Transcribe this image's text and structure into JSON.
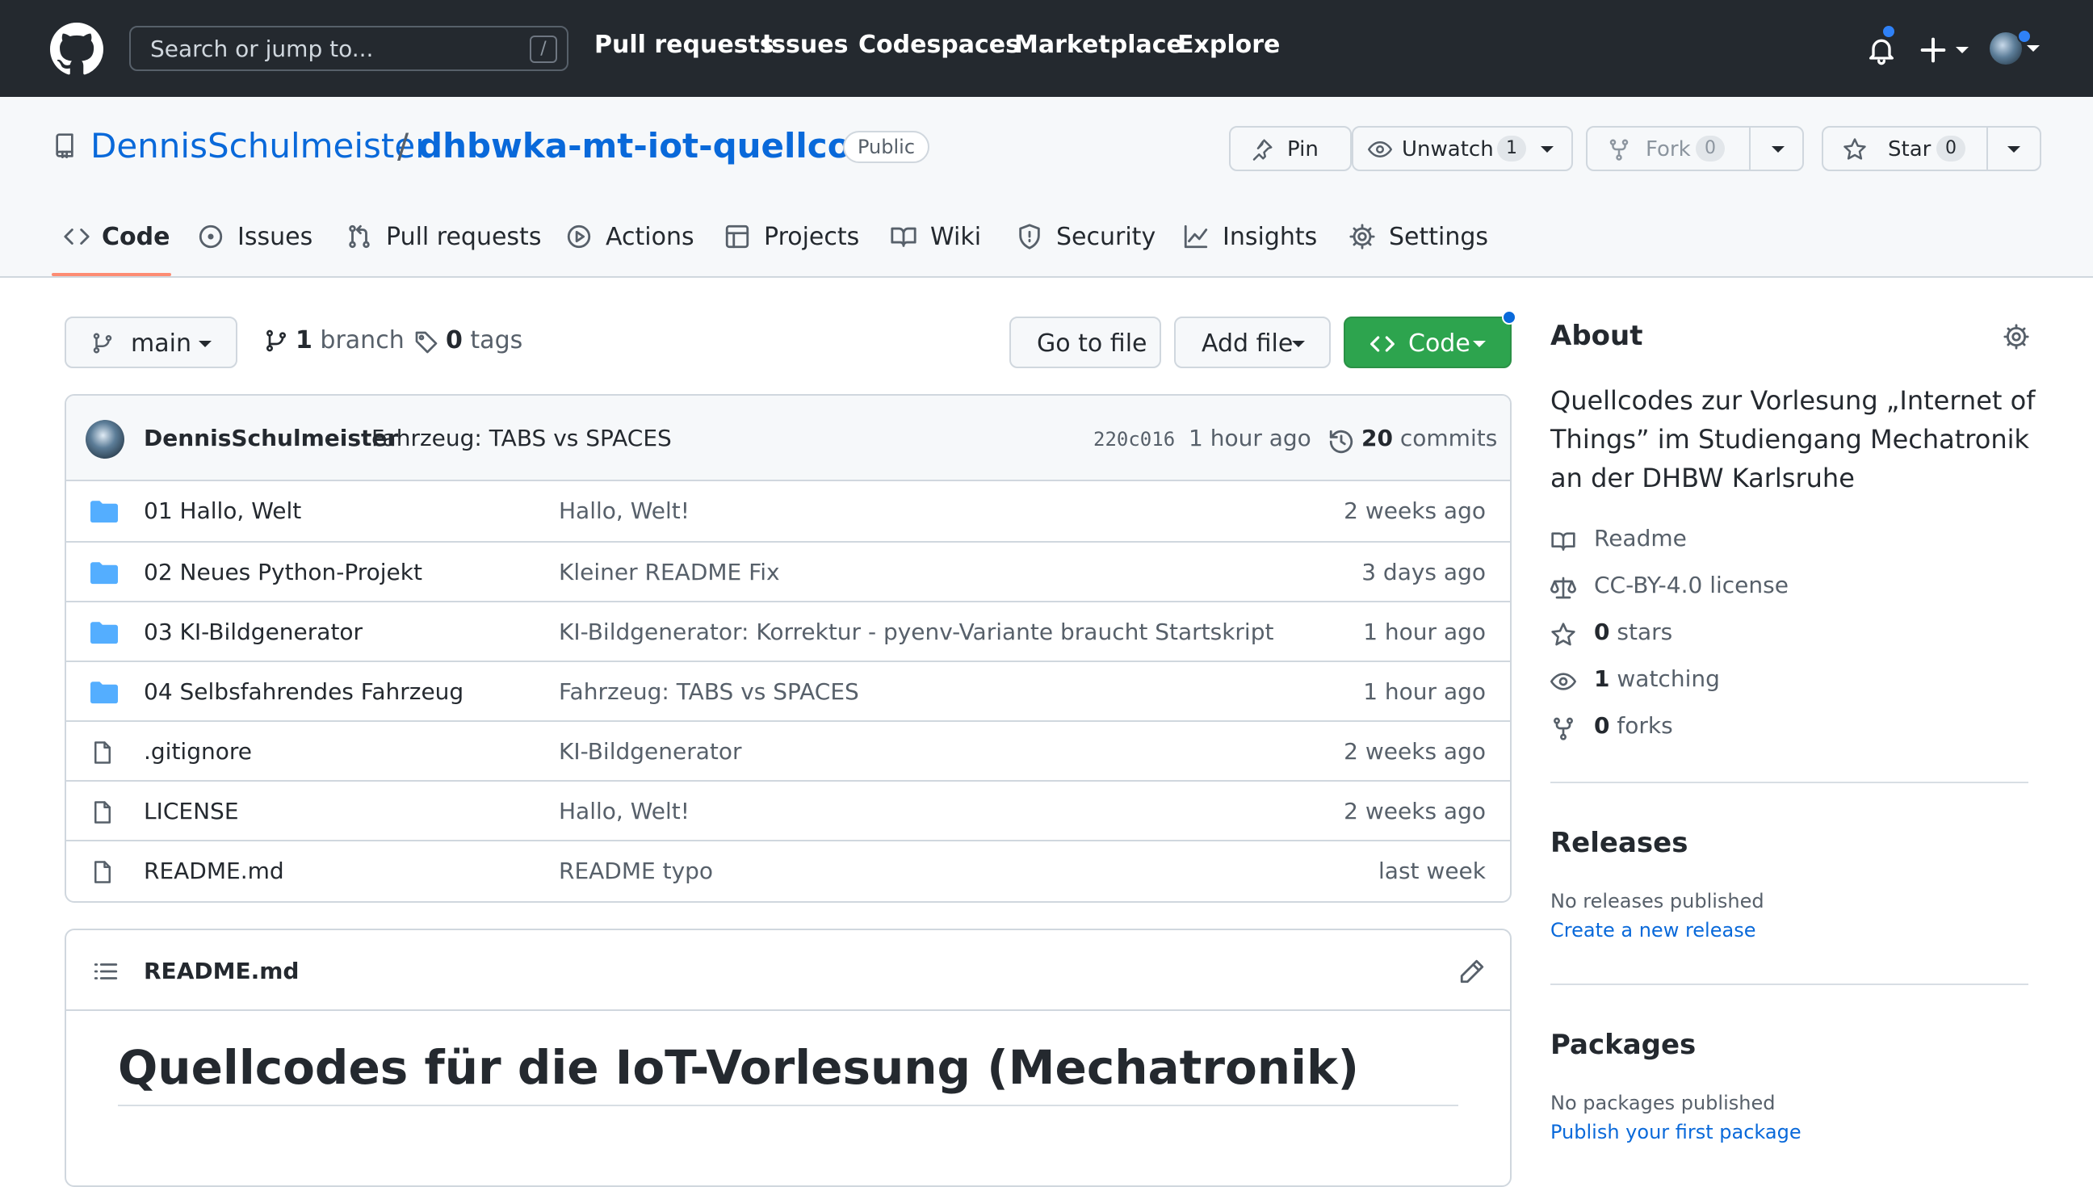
{
  "header": {
    "search_placeholder": "Search or jump to...",
    "search_shortcut": "/",
    "nav": [
      "Pull requests",
      "Issues",
      "Codespaces",
      "Marketplace",
      "Explore"
    ]
  },
  "repo": {
    "owner": "DennisSchulmeister",
    "separator": "/",
    "name": "dhbwka-mt-iot-quellcodes",
    "visibility": "Public",
    "pin_label": "Pin",
    "unwatch_label": "Unwatch",
    "watch_count": "1",
    "fork_label": "Fork",
    "fork_count": "0",
    "star_label": "Star",
    "star_count": "0"
  },
  "tabs": [
    "Code",
    "Issues",
    "Pull requests",
    "Actions",
    "Projects",
    "Wiki",
    "Security",
    "Insights",
    "Settings"
  ],
  "branchbar": {
    "branch": "main",
    "branch_count": "1",
    "branch_word": "branch",
    "tag_count": "0",
    "tag_word": "tags",
    "go_to_file": "Go to file",
    "add_file": "Add file",
    "code": "Code"
  },
  "commit": {
    "author": "DennisSchulmeister",
    "message": "Fahrzeug: TABS vs SPACES",
    "sha": "220c016",
    "time": "1 hour ago",
    "count": "20",
    "count_word": "commits"
  },
  "files": [
    {
      "type": "dir",
      "name": "01 Hallo, Welt",
      "message": "Hallo, Welt!",
      "age": "2 weeks ago"
    },
    {
      "type": "dir",
      "name": "02 Neues Python-Projekt",
      "message": "Kleiner README Fix",
      "age": "3 days ago"
    },
    {
      "type": "dir",
      "name": "03 KI-Bildgenerator",
      "message": "KI-Bildgenerator: Korrektur - pyenv-Variante braucht Startskript",
      "age": "1 hour ago"
    },
    {
      "type": "dir",
      "name": "04 Selbsfahrendes Fahrzeug",
      "message": "Fahrzeug: TABS vs SPACES",
      "age": "1 hour ago"
    },
    {
      "type": "file",
      "name": ".gitignore",
      "message": "KI-Bildgenerator",
      "age": "2 weeks ago"
    },
    {
      "type": "file",
      "name": "LICENSE",
      "message": "Hallo, Welt!",
      "age": "2 weeks ago"
    },
    {
      "type": "file",
      "name": "README.md",
      "message": "README typo",
      "age": "last week"
    }
  ],
  "readme": {
    "filename": "README.md",
    "heading": "Quellcodes für die IoT-Vorlesung (Mechatronik)"
  },
  "about": {
    "title": "About",
    "description": "Quellcodes zur Vorlesung „Internet of Things” im Studiengang Mechatronik an der DHBW Karlsruhe",
    "readme": "Readme",
    "license": "CC-BY-4.0 license",
    "stars_count": "0",
    "stars_word": "stars",
    "watching_count": "1",
    "watching_word": "watching",
    "forks_count": "0",
    "forks_word": "forks"
  },
  "releases": {
    "title": "Releases",
    "empty": "No releases published",
    "link": "Create a new release"
  },
  "packages": {
    "title": "Packages",
    "empty": "No packages published",
    "link": "Publish your first package"
  },
  "colors": {
    "header_bg": "#24292f",
    "link": "#0969da",
    "green_button": "#2da44e",
    "tab_underline": "#fd8c73",
    "folder": "#54aeff",
    "notification_dot": "#2f81f7"
  },
  "icons": [
    "github-logo-icon",
    "bell-icon",
    "plus-icon",
    "repo-icon",
    "pin-icon",
    "eye-icon",
    "fork-icon",
    "star-icon",
    "code-icon",
    "issue-icon",
    "pull-request-icon",
    "actions-icon",
    "projects-icon",
    "wiki-icon",
    "security-icon",
    "insights-icon",
    "settings-icon",
    "branch-icon",
    "tag-icon",
    "history-icon",
    "folder-icon",
    "file-icon",
    "list-icon",
    "pencil-icon",
    "book-icon",
    "law-icon"
  ]
}
